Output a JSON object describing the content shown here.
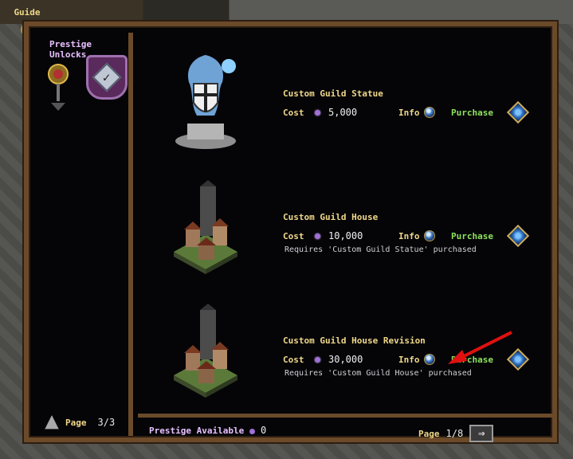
{
  "guide": {
    "label": "Guide"
  },
  "sidebar": {
    "title": "Prestige Unlocks",
    "page_label": "Page",
    "page_value": "3/3"
  },
  "items": [
    {
      "name": "Custom Guild Statue",
      "cost_label": "Cost",
      "cost_value": "5,000",
      "info_label": "Info",
      "purchase_label": "Purchase",
      "requires": ""
    },
    {
      "name": "Custom Guild House",
      "cost_label": "Cost",
      "cost_value": "10,000",
      "info_label": "Info",
      "purchase_label": "Purchase",
      "requires": "Requires 'Custom Guild Statue' purchased"
    },
    {
      "name": "Custom Guild House Revision",
      "cost_label": "Cost",
      "cost_value": "30,000",
      "info_label": "Info",
      "purchase_label": "Purchase",
      "requires": "Requires 'Custom Guild House' purchased"
    }
  ],
  "footer": {
    "prestige_label": "Prestige Available",
    "prestige_value": "0",
    "page_label": "Page",
    "page_value": "1/8"
  },
  "colors": {
    "frame": "#6b4a2a",
    "title_text": "#f0d888",
    "purchase_text": "#8ee35c",
    "prestige_text": "#e8c0ff",
    "annotation_arrow": "#e01010"
  }
}
